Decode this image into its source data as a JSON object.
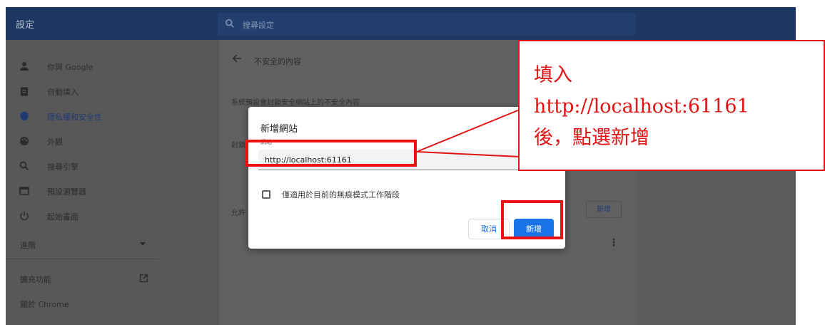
{
  "app": {
    "title": "設定",
    "search_placeholder": "搜尋設定"
  },
  "sidebar": {
    "items": [
      {
        "icon": "person-icon",
        "label": "你與 Google"
      },
      {
        "icon": "clipboard-icon",
        "label": "自動填入"
      },
      {
        "icon": "shield-icon",
        "label": "隱私權和安全性",
        "active": true
      },
      {
        "icon": "palette-icon",
        "label": "外觀"
      },
      {
        "icon": "search-icon",
        "label": "搜尋引擎"
      },
      {
        "icon": "browser-icon",
        "label": "預設瀏覽器"
      },
      {
        "icon": "power-icon",
        "label": "起始畫面"
      }
    ],
    "advanced": "進階",
    "extensions": "擴充功能",
    "about": "關於 Chrome"
  },
  "main": {
    "title": "不安全的內容",
    "description": "系統預設會封鎖安全網站上的不安全內容",
    "block_label": "封鎖",
    "allow_label": "允許",
    "add_button": "新增"
  },
  "dialog": {
    "title": "新增網站",
    "field_label": "網站",
    "field_value": "http://localhost:61161",
    "checkbox_label": "僅適用於目前的無痕模式工作階段",
    "cancel": "取消",
    "add": "新增"
  },
  "annotation": {
    "line1": "填入",
    "line2": "http://localhost:61161",
    "line3": "後，點選新增"
  },
  "colors": {
    "topbar": "#1d3662",
    "accent": "#1a73e8",
    "annotation_red": "#e11313"
  }
}
